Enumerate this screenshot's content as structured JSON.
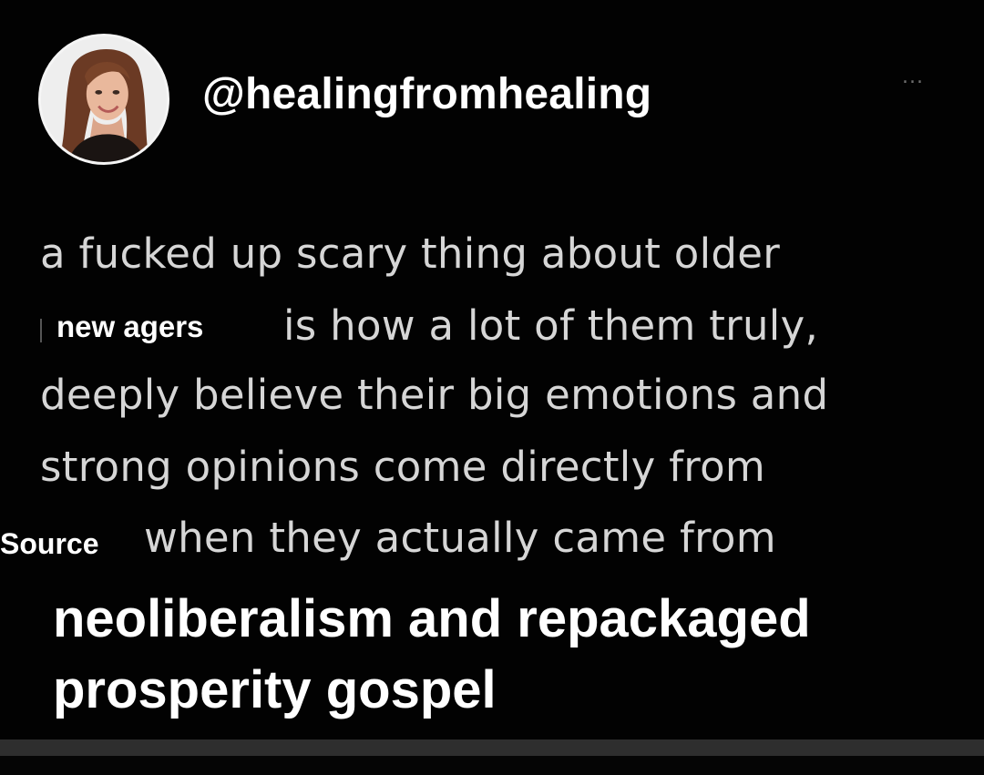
{
  "post": {
    "handle": "@healingfromhealing",
    "more_label": "...",
    "body_lines": [
      "a fucked up scary thing about older",
      "is how a lot of them truly,",
      "deeply believe their big emotions and",
      "strong opinions come directly from",
      "when they actually came from"
    ]
  },
  "overlays": {
    "new_agers": "new agers",
    "source": "Source",
    "ending_line1": "neoliberalism and repackaged",
    "ending_line2": "prosperity gospel"
  },
  "colors": {
    "background": "#020202",
    "body_text": "#d6d6d6",
    "overlay_text": "#ffffff"
  },
  "icons": {
    "avatar": "profile-photo",
    "more": "more-options-icon"
  }
}
